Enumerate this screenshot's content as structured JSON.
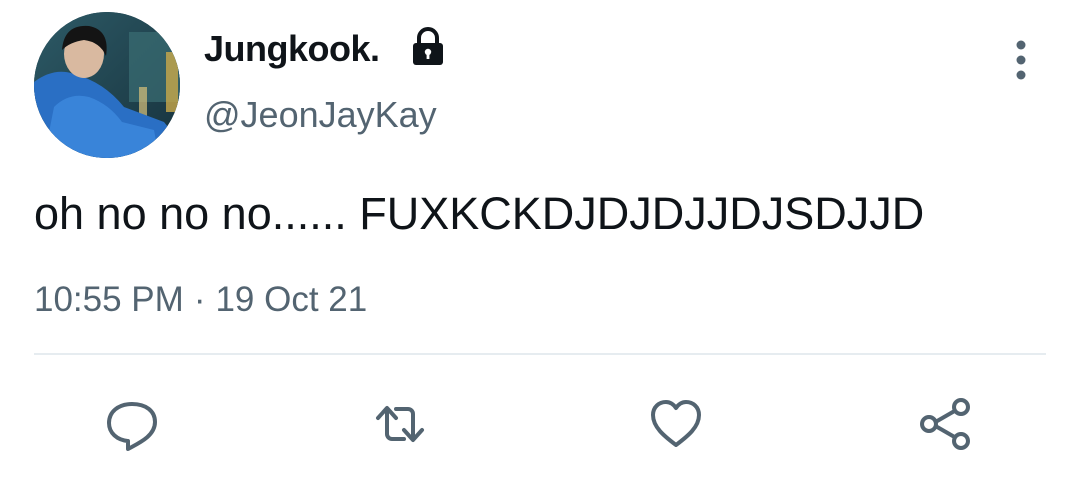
{
  "user": {
    "display_name": "Jungkook.",
    "handle": "@JeonJayKay",
    "protected_icon": "lock-icon",
    "avatar": "profile-photo"
  },
  "tweet": {
    "text": "oh no no no...... FUXKCKDJDJDJJDJSDJJD",
    "time": "10:55 PM",
    "separator": "·",
    "date": "19 Oct 21"
  },
  "actions": {
    "reply_icon": "reply-icon",
    "retweet_icon": "retweet-icon",
    "like_icon": "heart-icon",
    "share_icon": "share-icon",
    "more_icon": "more-vertical-icon"
  },
  "colors": {
    "text_primary": "#0f1419",
    "text_secondary": "#536471",
    "divider": "#e6ecf0"
  }
}
